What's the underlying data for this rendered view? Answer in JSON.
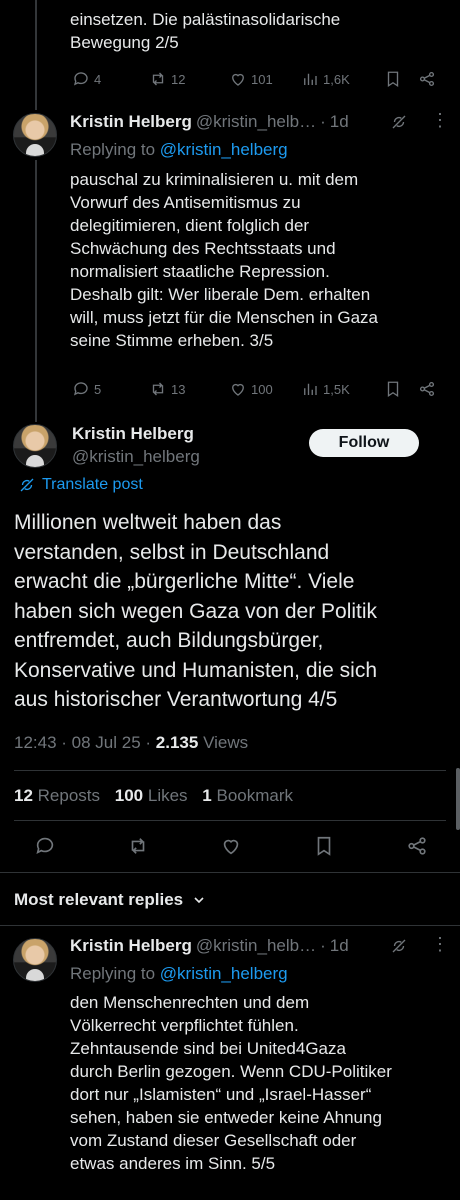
{
  "top_tweet": {
    "text_lines": [
      "einsetzen. Die palästinasolidarische",
      "Bewegung  2/5"
    ],
    "replies": "4",
    "reposts": "12",
    "likes": "101",
    "views": "1,6K"
  },
  "tweet3": {
    "name": "Kristin Helberg",
    "handle": "@kristin_helb…",
    "age": "1d",
    "replying_prefix": "Replying to ",
    "replying_handle": "@kristin_helberg",
    "text_lines": [
      "pauschal zu kriminalisieren u. mit dem",
      "Vorwurf des Antisemitismus zu",
      "delegitimieren, dient folglich der",
      "Schwächung des Rechtsstaats und",
      "normalisiert staatliche Repression.",
      "Deshalb gilt: Wer liberale Dem. erhalten",
      "will, muss jetzt für die Menschen in Gaza",
      "seine Stimme erheben. 3/5"
    ],
    "replies": "5",
    "reposts": "13",
    "likes": "100",
    "views": "1,5K"
  },
  "main_tweet": {
    "name": "Kristin Helberg",
    "handle": "@kristin_helberg",
    "follow_label": "Follow",
    "translate_label": "Translate post",
    "text_lines": [
      "Millionen weltweit haben das",
      "verstanden, selbst in Deutschland",
      "erwacht die „bürgerliche Mitte“. Viele",
      "haben sich wegen Gaza von der Politik",
      "entfremdet, auch Bildungsbürger,",
      "Konservative und Humanisten, die sich",
      "aus historischer Verantwortung 4/5"
    ],
    "time": "12:43",
    "date": "08 Jul 25",
    "views_count": "2.135",
    "views_label": "Views",
    "reposts_count": "12",
    "reposts_label": "Reposts",
    "likes_count": "100",
    "likes_label": "Likes",
    "bookmarks_count": "1",
    "bookmarks_label": "Bookmark"
  },
  "replies_section": {
    "title": "Most relevant replies"
  },
  "reply_tweet": {
    "name": "Kristin Helberg",
    "handle": "@kristin_helb…",
    "age": "1d",
    "replying_prefix": "Replying to ",
    "replying_handle": "@kristin_helberg",
    "text_lines": [
      "den Menschenrechten und dem",
      "Völkerrecht verpflichtet fühlen.",
      "Zehntausende sind bei United4Gaza",
      "durch Berlin gezogen. Wenn CDU-Politiker",
      "dort nur „Islamisten“ und „Israel-Hasser“",
      "sehen, haben sie entweder keine Ahnung",
      "vom Zustand dieser Gesellschaft oder",
      "etwas anderes im Sinn. 5/5"
    ]
  },
  "colors": {
    "background": "#000000",
    "text": "#e7e9ea",
    "muted": "#71767b",
    "link": "#1d9bf0",
    "divider": "#2f3336"
  }
}
